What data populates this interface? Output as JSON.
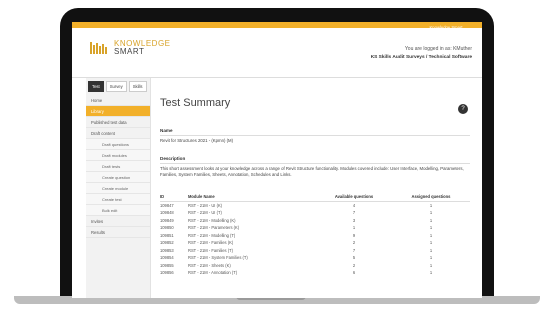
{
  "header": {
    "top_button": "Knowledge Smart",
    "logo_word1": "KNOWLEDGE",
    "logo_word2": "SMART",
    "login_text": "You are logged in as: KMuther",
    "org_text": "KS Skills Audit Surveys / Technical Software"
  },
  "sidebar": {
    "tabs": [
      "Test",
      "Survey",
      "Skills"
    ],
    "items": [
      {
        "label": "Home",
        "type": "item"
      },
      {
        "label": "Library",
        "type": "active"
      },
      {
        "label": "Published test data",
        "type": "item"
      },
      {
        "label": "Draft content",
        "type": "item"
      },
      {
        "label": "Draft questions",
        "type": "sub"
      },
      {
        "label": "Draft modules",
        "type": "sub"
      },
      {
        "label": "Draft tests",
        "type": "sub"
      },
      {
        "label": "Create question",
        "type": "sub"
      },
      {
        "label": "Create module",
        "type": "sub"
      },
      {
        "label": "Create test",
        "type": "sub"
      },
      {
        "label": "Bulk edit",
        "type": "sub"
      },
      {
        "label": "Invites",
        "type": "item"
      },
      {
        "label": "Results",
        "type": "item"
      }
    ]
  },
  "main": {
    "title": "Test Summary",
    "help_icon": "?",
    "name_label": "Name",
    "name_value": "Revit for Structures 2021 - (Kpmn) (M)",
    "desc_label": "Description",
    "desc_value": "This short assessment looks at your knowledge across a range of Revit Structure functionality. Modules covered include: User Interface, Modelling, Parameters, Families, System Families, Sheets, Annotation, Schedules and Links.",
    "table": {
      "headers": [
        "ID",
        "Module Name",
        "Available questions",
        "Assigned questions"
      ],
      "rows": [
        [
          "109847",
          "RST - 21M - UI (K)",
          "4",
          "1"
        ],
        [
          "109848",
          "RST - 21M - UI (T)",
          "7",
          "1"
        ],
        [
          "109849",
          "RST - 21M - Modelling (K)",
          "3",
          "1"
        ],
        [
          "109850",
          "RST - 21M - Parameters (K)",
          "1",
          "1"
        ],
        [
          "109851",
          "RST - 21M - Modelling (T)",
          "9",
          "1"
        ],
        [
          "109852",
          "RST - 21M - Families (K)",
          "2",
          "1"
        ],
        [
          "109853",
          "RST - 21M - Families (T)",
          "7",
          "1"
        ],
        [
          "109854",
          "RST - 21M - System Families (T)",
          "5",
          "1"
        ],
        [
          "109855",
          "RST - 21M - Sheets (K)",
          "2",
          "1"
        ],
        [
          "109856",
          "RST - 21M - Annotation (T)",
          "6",
          "1"
        ]
      ]
    }
  }
}
